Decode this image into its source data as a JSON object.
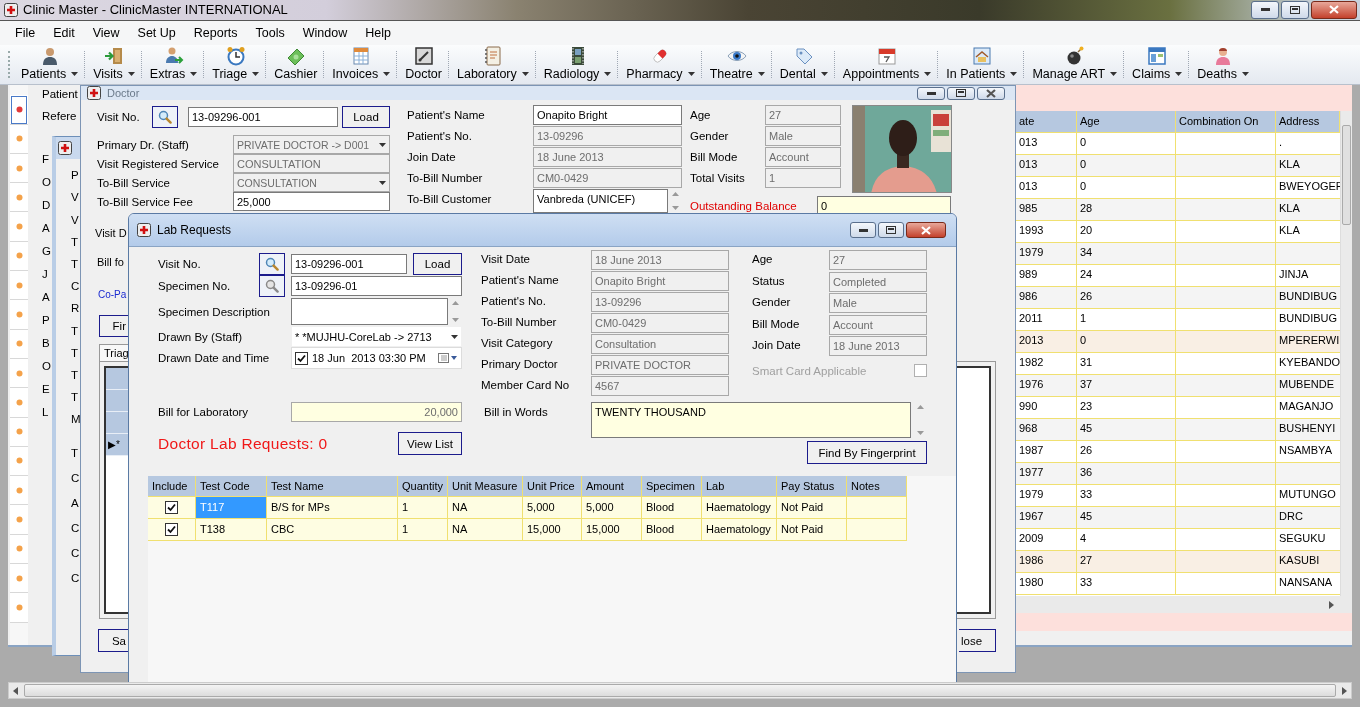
{
  "window": {
    "title": "Clinic Master - ClinicMaster INTERNATIONAL"
  },
  "menu": [
    "File",
    "Edit",
    "View",
    "Set Up",
    "Reports",
    "Tools",
    "Window",
    "Help"
  ],
  "toolbar": [
    {
      "label": "Patients",
      "dropdown": true
    },
    {
      "label": "Visits",
      "dropdown": true
    },
    {
      "label": "Extras",
      "dropdown": true
    },
    {
      "label": "Triage",
      "dropdown": true
    },
    {
      "label": "Cashier",
      "dropdown": false
    },
    {
      "label": "Invoices",
      "dropdown": true
    },
    {
      "label": "Doctor",
      "dropdown": false
    },
    {
      "label": "Laboratory",
      "dropdown": true
    },
    {
      "label": "Radiology",
      "dropdown": true
    },
    {
      "label": "Pharmacy",
      "dropdown": true
    },
    {
      "label": "Theatre",
      "dropdown": true
    },
    {
      "label": "Dental",
      "dropdown": true
    },
    {
      "label": "Appointments",
      "dropdown": true
    },
    {
      "label": "In Patients",
      "dropdown": true
    },
    {
      "label": "Manage ART",
      "dropdown": true
    },
    {
      "label": "Claims",
      "dropdown": true
    },
    {
      "label": "Deaths",
      "dropdown": true
    }
  ],
  "patients_window": {
    "labels": [
      "Patient",
      "Refere"
    ],
    "partial_labels": [
      "F",
      "O",
      "D",
      "A",
      "G",
      "J",
      "A",
      "P",
      "B",
      "O",
      "E",
      "L"
    ],
    "row_markers": [
      {
        "selected": true
      },
      {
        "selected": false
      },
      {
        "selected": false
      },
      {
        "selected": false
      },
      {
        "selected": false
      },
      {
        "selected": false
      },
      {
        "selected": false
      },
      {
        "selected": false
      },
      {
        "selected": false
      },
      {
        "selected": false
      },
      {
        "selected": false
      },
      {
        "selected": false
      },
      {
        "selected": false
      },
      {
        "selected": false
      },
      {
        "selected": false
      },
      {
        "selected": false
      },
      {
        "selected": false
      },
      {
        "selected": false
      }
    ],
    "grid": {
      "columns": [
        "ate",
        "Age",
        "Combination On",
        "Address"
      ],
      "rows": [
        {
          "column_1": "013",
          "age": "0",
          "address": ".",
          "highlighted": false
        },
        {
          "column_1": "013",
          "age": "0",
          "address": "KLA",
          "highlighted": false
        },
        {
          "column_1": "013",
          "age": "0",
          "address": "BWEYOGEF",
          "highlighted": false
        },
        {
          "column_1": "985",
          "age": "28",
          "address": "KLA",
          "highlighted": false
        },
        {
          "column_1": "1993",
          "age": "20",
          "address": "KLA",
          "highlighted": false
        },
        {
          "column_1": "1979",
          "age": "34",
          "highlighted": false
        },
        {
          "column_1": "989",
          "age": "24",
          "address": "JINJA",
          "highlighted": false
        },
        {
          "column_1": "986",
          "age": "26",
          "address": "BUNDIBUG",
          "highlighted": false
        },
        {
          "column_1": "2011",
          "age": "1",
          "address": "BUNDIBUG",
          "highlighted": false
        },
        {
          "column_1": "2013",
          "age": "0",
          "address": "MPERERWI",
          "highlighted": true
        },
        {
          "column_1": "1982",
          "age": "31",
          "address": "KYEBANDO",
          "highlighted": false
        },
        {
          "column_1": "1976",
          "age": "37",
          "address": "MUBENDE",
          "highlighted": false
        },
        {
          "column_1": "990",
          "age": "23",
          "address": "MAGANJO",
          "highlighted": false
        },
        {
          "column_1": "968",
          "age": "45",
          "address": "BUSHENYI",
          "highlighted": false
        },
        {
          "column_1": "1987",
          "age": "26",
          "address": "NSAMBYA",
          "highlighted": false
        },
        {
          "column_1": "1977",
          "age": "36",
          "highlighted": false
        },
        {
          "column_1": "1979",
          "age": "33",
          "address": "MUTUNGO",
          "highlighted": false
        },
        {
          "column_1": "1967",
          "age": "45",
          "address": "DRC",
          "highlighted": false
        },
        {
          "column_1": "2009",
          "age": "4",
          "address": "SEGUKU",
          "highlighted": false
        },
        {
          "column_1": "1986",
          "age": "27",
          "address": "KASUBI",
          "highlighted": true
        },
        {
          "column_1": "1980",
          "age": "33",
          "address": "NANSANA",
          "highlighted": false
        }
      ]
    }
  },
  "visit_window": {
    "labels": [
      "P",
      "V",
      "V",
      "T",
      "T",
      "C",
      "R",
      "T",
      "T",
      "T",
      "T",
      "M"
    ],
    "lower_labels": [
      "T",
      "C",
      "A",
      "C",
      "C",
      "C"
    ]
  },
  "doctor_window": {
    "title": "Doctor",
    "visit_no": {
      "label": "Visit No.",
      "value": "13-09296-001",
      "button": "Load"
    },
    "left_fields": [
      {
        "label": "Primary Dr. (Staff)",
        "value": "PRIVATE DOCTOR -> D001",
        "kind": "combo",
        "disabled": true
      },
      {
        "label": "Visit Registered Service",
        "value": "CONSULTATION",
        "kind": "text",
        "disabled": true
      },
      {
        "label": "To-Bill Service",
        "value": "CONSULTATION",
        "kind": "combo",
        "disabled": true
      },
      {
        "label": "To-Bill Service Fee",
        "value": "25,000",
        "kind": "text",
        "disabled": false
      }
    ],
    "patient_fields": [
      {
        "label": "Patient's Name",
        "value": "Onapito Bright",
        "kind": "text",
        "disabled": false
      },
      {
        "label": "Patient's No.",
        "value": "13-09296",
        "kind": "text",
        "disabled": true
      },
      {
        "label": "Join Date",
        "value": "18 June 2013",
        "kind": "text",
        "disabled": true
      },
      {
        "label": "To-Bill Number",
        "value": "CM0-0429",
        "kind": "text",
        "disabled": true
      },
      {
        "label": "To-Bill Customer",
        "value": "Vanbreda (UNICEF)",
        "kind": "memo",
        "disabled": false
      }
    ],
    "summary_fields": [
      {
        "label": "Age",
        "value": "27",
        "disabled": true
      },
      {
        "label": "Gender",
        "value": "Male",
        "disabled": true
      },
      {
        "label": "Bill Mode",
        "value": "Account",
        "disabled": true
      },
      {
        "label": "Total Visits",
        "value": "1",
        "disabled": true
      }
    ],
    "outstanding_balance": {
      "label": "Outstanding Balance",
      "value": "0"
    },
    "partial_labels": [
      "Visit D",
      "Bill fo"
    ],
    "copay_link": "Co-Pa",
    "find_button": "Fir",
    "tab": "Triag",
    "new_row_marker": "▶*",
    "save_button": "Sa",
    "close_button": "lose"
  },
  "lab_window": {
    "title": "Lab Requests",
    "visit_no": {
      "label": "Visit No.",
      "value": "13-09296-001",
      "button": "Load"
    },
    "specimen_no": {
      "label": "Specimen No.",
      "value": "13-09296-01",
      "search_disabled": true
    },
    "specimen_description": {
      "label": "Specimen Description"
    },
    "drawn_by": {
      "label": "Drawn By (Staff)",
      "value": "* *MUJHU-CoreLab -> 2713"
    },
    "drawn_date": {
      "label": "Drawn Date and Time",
      "value": "18 Jun  2013 03:30 PM",
      "checked": true
    },
    "bill": {
      "label": "Bill for Laboratory",
      "value": "20,000"
    },
    "requests_count": "Doctor Lab Requests: 0",
    "view_list_button": "View List",
    "details": [
      {
        "label": "Visit Date",
        "value": "18 June 2013"
      },
      {
        "label": "Patient's Name",
        "value": "Onapito Bright"
      },
      {
        "label": "Patient's No.",
        "value": "13-09296"
      },
      {
        "label": "To-Bill Number",
        "value": "CM0-0429"
      },
      {
        "label": "Visit Category",
        "value": "Consultation"
      },
      {
        "label": "Primary Doctor",
        "value": "PRIVATE DOCTOR"
      },
      {
        "label": "Member Card No",
        "value": "4567"
      }
    ],
    "status_fields": [
      {
        "label": "Age",
        "value": "27"
      },
      {
        "label": "Status",
        "value": "Completed"
      },
      {
        "label": "Gender",
        "value": "Male"
      },
      {
        "label": "Bill Mode",
        "value": "Account"
      },
      {
        "label": "Join Date",
        "value": "18 June 2013"
      }
    ],
    "smart_card": {
      "label": "Smart Card Applicable",
      "checked": false,
      "disabled": true
    },
    "bill_in_words": {
      "label": "Bill in Words",
      "value": "TWENTY THOUSAND"
    },
    "fingerprint_button": "Find By Fingerprint",
    "table": {
      "include_column": "Include",
      "columns": [
        "Test Code",
        "Test Name",
        "Quantity",
        "Unit Measure",
        "Unit Price",
        "Amount",
        "Specimen",
        "Lab",
        "Pay Status",
        "Notes"
      ],
      "rows": [
        {
          "include": true,
          "selected": true,
          "cells": [
            "T117",
            "B/S for MPs",
            "1",
            "NA",
            "5,000",
            "5,000",
            "Blood",
            "Haematology",
            "Not Paid"
          ]
        },
        {
          "include": true,
          "selected": false,
          "cells": [
            "T138",
            "CBC",
            "1",
            "NA",
            "15,000",
            "15,000",
            "Blood",
            "Haematology",
            "Not Paid"
          ]
        }
      ]
    }
  }
}
